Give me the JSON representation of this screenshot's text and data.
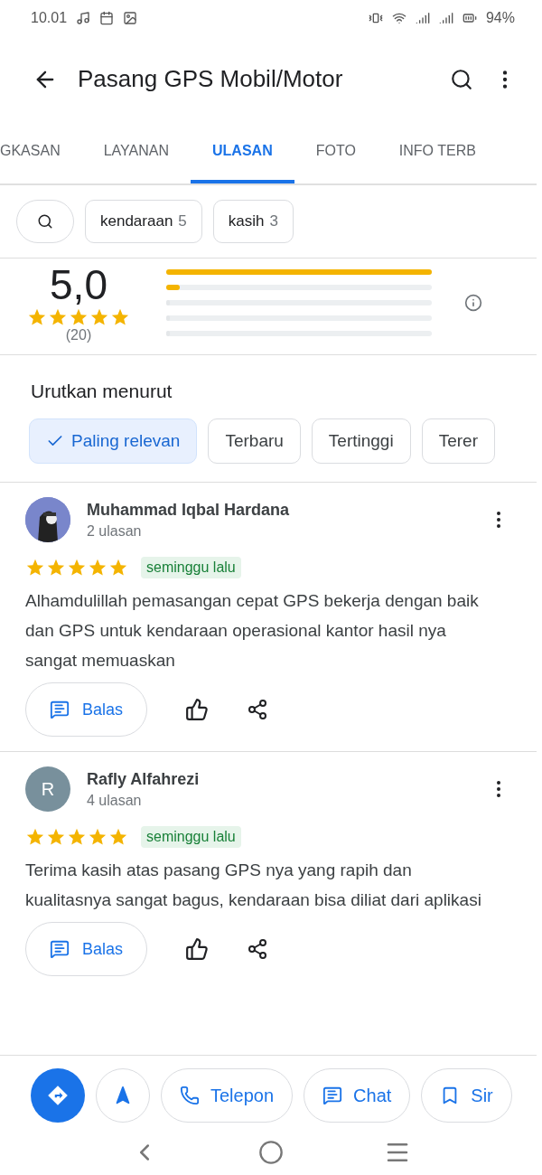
{
  "status_bar": {
    "time": "10.01",
    "battery": "94%"
  },
  "app_bar": {
    "title": "Pasang GPS Mobil/Motor"
  },
  "tabs": [
    {
      "label": "GKASAN",
      "selected": false
    },
    {
      "label": "LAYANAN",
      "selected": false
    },
    {
      "label": "ULASAN",
      "selected": true
    },
    {
      "label": "FOTO",
      "selected": false
    },
    {
      "label": "INFO TERB",
      "selected": false
    }
  ],
  "keyword_chips": [
    {
      "word": "kendaraan",
      "count": "5"
    },
    {
      "word": "kasih",
      "count": "3"
    }
  ],
  "rating": {
    "score": "5,0",
    "stars": 5,
    "count": "(20)",
    "bars": [
      {
        "level": 1.0
      },
      {
        "level": 0.05
      },
      {
        "level": 0
      },
      {
        "level": 0
      },
      {
        "level": 0
      }
    ]
  },
  "sort": {
    "title": "Urutkan menurut",
    "options": [
      {
        "label": "Paling relevan",
        "selected": true
      },
      {
        "label": "Terbaru",
        "selected": false
      },
      {
        "label": "Tertinggi",
        "selected": false
      },
      {
        "label": "Terer",
        "selected": false
      }
    ]
  },
  "reviews": [
    {
      "name": "Muhammad Iqbal Hardana",
      "meta": "2 ulasan",
      "stars": 5,
      "time": "seminggu lalu",
      "text": "Alhamdulillah pemasangan cepat GPS bekerja dengan baik dan GPS untuk kendaraan operasional kantor hasil nya sangat memuaskan",
      "reply": "Balas"
    },
    {
      "name": "Rafly Alfahrezi",
      "avatar": {
        "kind": "letter",
        "letter": "R",
        "color": "#78909c"
      },
      "meta": "4 ulasan",
      "stars": 5,
      "time": "seminggu lalu",
      "text": "Terima kasih atas pasang GPS nya yang rapih dan kualitasnya sangat bagus, kendaraan bisa diliat dari aplikasi",
      "reply": "Balas"
    }
  ],
  "actions": [
    {
      "kind": "directions"
    },
    {
      "kind": "start"
    },
    {
      "kind": "phone",
      "label": "Telepon"
    },
    {
      "kind": "chat",
      "label": "Chat"
    },
    {
      "kind": "save",
      "label": "Sir"
    }
  ]
}
